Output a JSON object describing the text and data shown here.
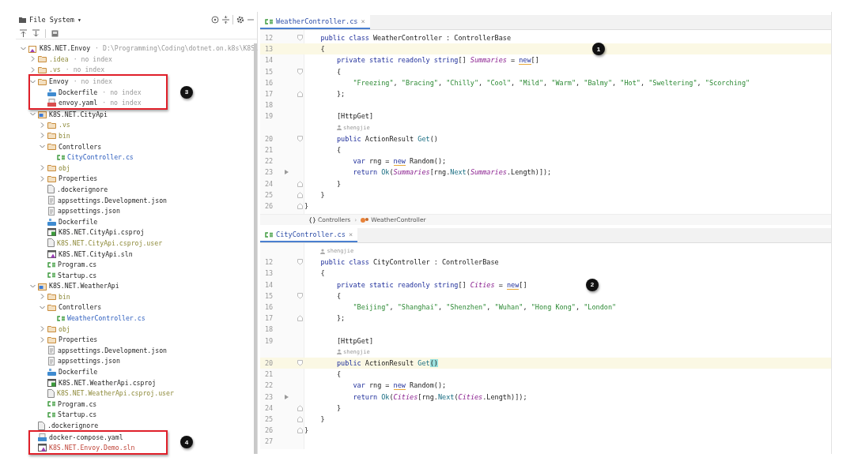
{
  "file_panel": {
    "title": "File System",
    "title_caret": "▾",
    "tree": [
      {
        "name": "K8S.NET.Envoy",
        "hint": "· D:\\Programming\\Coding\\dotnet.on.k8s\\K8S.",
        "kind": "solution",
        "ignored": false,
        "modified": false,
        "unversioned": false,
        "framed": false,
        "expanded": true,
        "children": [
          {
            "name": ".idea",
            "hint": "· no index",
            "kind": "folder",
            "ignored": true,
            "modified": false,
            "unversioned": false,
            "framed": false,
            "expanded": false
          },
          {
            "name": ".vs",
            "hint": "· no index",
            "kind": "folder",
            "ignored": true,
            "modified": false,
            "unversioned": false,
            "framed": false,
            "expanded": false
          },
          {
            "name": "Envoy",
            "hint": "· no index",
            "kind": "folder",
            "ignored": false,
            "modified": false,
            "unversioned": false,
            "framed": true,
            "callout": "3",
            "expanded": true,
            "children": [
              {
                "name": "Dockerfile",
                "hint": "· no index",
                "kind": "docker",
                "ignored": false,
                "modified": false,
                "unversioned": false,
                "framed": true
              },
              {
                "name": "envoy.yaml",
                "hint": "· no index",
                "kind": "yaml",
                "ignored": false,
                "modified": false,
                "unversioned": false,
                "framed": true
              }
            ]
          },
          {
            "name": "K8S.NET.CityApi",
            "kind": "project",
            "ignored": false,
            "modified": false,
            "unversioned": false,
            "framed": false,
            "expanded": true,
            "children": [
              {
                "name": ".vs",
                "kind": "folder",
                "ignored": true,
                "modified": false,
                "unversioned": false,
                "framed": false,
                "expanded": false
              },
              {
                "name": "bin",
                "kind": "folder",
                "ignored": true,
                "modified": false,
                "unversioned": false,
                "framed": false,
                "expanded": false
              },
              {
                "name": "Controllers",
                "kind": "folder",
                "ignored": false,
                "modified": false,
                "unversioned": false,
                "framed": false,
                "expanded": true,
                "children": [
                  {
                    "name": "CityController.cs",
                    "kind": "csharp",
                    "ignored": false,
                    "modified": true,
                    "unversioned": false,
                    "framed": false
                  }
                ]
              },
              {
                "name": "obj",
                "kind": "folder",
                "ignored": true,
                "modified": false,
                "unversioned": false,
                "framed": false,
                "expanded": false
              },
              {
                "name": "Properties",
                "kind": "folder",
                "ignored": false,
                "modified": false,
                "unversioned": false,
                "framed": false,
                "expanded": false
              },
              {
                "name": ".dockerignore",
                "kind": "text",
                "ignored": false,
                "modified": false,
                "unversioned": false,
                "framed": false
              },
              {
                "name": "appsettings.Development.json",
                "kind": "json",
                "ignored": false,
                "modified": false,
                "unversioned": false,
                "framed": false
              },
              {
                "name": "appsettings.json",
                "kind": "json",
                "ignored": false,
                "modified": false,
                "unversioned": false,
                "framed": false
              },
              {
                "name": "Dockerfile",
                "kind": "docker",
                "ignored": false,
                "modified": false,
                "unversioned": false,
                "framed": false
              },
              {
                "name": "K8S.NET.CityApi.csproj",
                "kind": "csproj",
                "ignored": false,
                "modified": false,
                "unversioned": false,
                "framed": false
              },
              {
                "name": "K8S.NET.CityApi.csproj.user",
                "kind": "text",
                "ignored": true,
                "modified": false,
                "unversioned": false,
                "framed": false
              },
              {
                "name": "K8S.NET.CityApi.sln",
                "kind": "sln",
                "ignored": false,
                "modified": false,
                "unversioned": false,
                "framed": false
              },
              {
                "name": "Program.cs",
                "kind": "csharp",
                "ignored": false,
                "modified": false,
                "unversioned": false,
                "framed": false
              },
              {
                "name": "Startup.cs",
                "kind": "csharp",
                "ignored": false,
                "modified": false,
                "unversioned": false,
                "framed": false
              }
            ]
          },
          {
            "name": "K8S.NET.WeatherApi",
            "kind": "project",
            "ignored": false,
            "modified": false,
            "unversioned": false,
            "framed": false,
            "expanded": true,
            "children": [
              {
                "name": "bin",
                "kind": "folder",
                "ignored": true,
                "modified": false,
                "unversioned": false,
                "framed": false,
                "expanded": false
              },
              {
                "name": "Controllers",
                "kind": "folder",
                "ignored": false,
                "modified": false,
                "unversioned": false,
                "framed": false,
                "expanded": true,
                "children": [
                  {
                    "name": "WeatherController.cs",
                    "kind": "csharp",
                    "ignored": false,
                    "modified": true,
                    "unversioned": false,
                    "framed": false
                  }
                ]
              },
              {
                "name": "obj",
                "kind": "folder",
                "ignored": true,
                "modified": false,
                "unversioned": false,
                "framed": false,
                "expanded": false
              },
              {
                "name": "Properties",
                "kind": "folder",
                "ignored": false,
                "modified": false,
                "unversioned": false,
                "framed": false,
                "expanded": false
              },
              {
                "name": "appsettings.Development.json",
                "kind": "json",
                "ignored": false,
                "modified": false,
                "unversioned": false,
                "framed": false
              },
              {
                "name": "appsettings.json",
                "kind": "json",
                "ignored": false,
                "modified": false,
                "unversioned": false,
                "framed": false
              },
              {
                "name": "Dockerfile",
                "kind": "docker",
                "ignored": false,
                "modified": false,
                "unversioned": false,
                "framed": false
              },
              {
                "name": "K8S.NET.WeatherApi.csproj",
                "kind": "csproj",
                "ignored": false,
                "modified": false,
                "unversioned": false,
                "framed": false
              },
              {
                "name": "K8S.NET.WeatherApi.csproj.user",
                "kind": "text",
                "ignored": true,
                "modified": false,
                "unversioned": false,
                "framed": false
              },
              {
                "name": "Program.cs",
                "kind": "csharp",
                "ignored": false,
                "modified": false,
                "unversioned": false,
                "framed": false
              },
              {
                "name": "Startup.cs",
                "kind": "csharp",
                "ignored": false,
                "modified": false,
                "unversioned": false,
                "framed": false
              }
            ]
          },
          {
            "name": ".dockerignore",
            "kind": "text",
            "ignored": false,
            "modified": false,
            "unversioned": false,
            "framed": false
          },
          {
            "name": "docker-compose.yaml",
            "kind": "compose",
            "ignored": false,
            "modified": false,
            "unversioned": false,
            "framed": true,
            "callout": "4"
          },
          {
            "name": "K8S.NET.Envoy.Demo.sln",
            "kind": "sln",
            "ignored": false,
            "modified": false,
            "unversioned": true,
            "framed": true
          }
        ]
      }
    ]
  },
  "editors": [
    {
      "tab": {
        "title": "WeatherController.cs",
        "close": "×"
      },
      "lines": [
        {
          "kind": "code",
          "number": "12",
          "fold_start": true,
          "fold_end": false,
          "run": false,
          "current": false,
          "tokens": [
            {
              "kind": "kw",
              "text": "    public class "
            },
            {
              "kind": "plain",
              "text": "WeatherController : ControllerBase"
            }
          ]
        },
        {
          "kind": "code",
          "number": "13",
          "fold_start": false,
          "fold_end": false,
          "run": false,
          "current": true,
          "callout": "1",
          "tokens": [
            {
              "kind": "plain",
              "text": "    {"
            }
          ]
        },
        {
          "kind": "code",
          "number": "14",
          "fold_start": false,
          "fold_end": false,
          "run": false,
          "current": false,
          "tokens": [
            {
              "kind": "kw",
              "text": "        private static readonly string"
            },
            {
              "kind": "plain",
              "text": "[] "
            },
            {
              "kind": "field",
              "text": "Summaries"
            },
            {
              "kind": "plain",
              "text": " = "
            },
            {
              "kind": "warn",
              "text": "new"
            },
            {
              "kind": "plain",
              "text": "[]"
            }
          ]
        },
        {
          "kind": "code",
          "number": "15",
          "fold_start": true,
          "fold_end": false,
          "run": false,
          "current": false,
          "tokens": [
            {
              "kind": "plain",
              "text": "        {"
            }
          ]
        },
        {
          "kind": "code",
          "number": "16",
          "fold_start": false,
          "fold_end": false,
          "run": false,
          "current": false,
          "tokens": [
            {
              "kind": "str",
              "text": "            \"Freezing\""
            },
            {
              "kind": "plain",
              "text": ", "
            },
            {
              "kind": "str",
              "text": "\"Bracing\""
            },
            {
              "kind": "plain",
              "text": ", "
            },
            {
              "kind": "str",
              "text": "\"Chilly\""
            },
            {
              "kind": "plain",
              "text": ", "
            },
            {
              "kind": "str",
              "text": "\"Cool\""
            },
            {
              "kind": "plain",
              "text": ", "
            },
            {
              "kind": "str",
              "text": "\"Mild\""
            },
            {
              "kind": "plain",
              "text": ", "
            },
            {
              "kind": "str",
              "text": "\"Warm\""
            },
            {
              "kind": "plain",
              "text": ", "
            },
            {
              "kind": "str",
              "text": "\"Balmy\""
            },
            {
              "kind": "plain",
              "text": ", "
            },
            {
              "kind": "str",
              "text": "\"Hot\""
            },
            {
              "kind": "plain",
              "text": ", "
            },
            {
              "kind": "str",
              "text": "\"Sweltering\""
            },
            {
              "kind": "plain",
              "text": ", "
            },
            {
              "kind": "str",
              "text": "\"Scorching\""
            }
          ]
        },
        {
          "kind": "code",
          "number": "17",
          "fold_start": false,
          "fold_end": true,
          "run": false,
          "current": false,
          "tokens": [
            {
              "kind": "plain",
              "text": "        };"
            }
          ]
        },
        {
          "kind": "code",
          "number": "18",
          "fold_start": false,
          "fold_end": false,
          "run": false,
          "current": false
        },
        {
          "kind": "code",
          "number": "19",
          "fold_start": false,
          "fold_end": false,
          "run": false,
          "current": false,
          "tokens": [
            {
              "kind": "plain",
              "text": "        [HttpGet]"
            }
          ]
        },
        {
          "kind": "author",
          "text": "shengjie"
        },
        {
          "kind": "code",
          "number": "20",
          "fold_start": true,
          "fold_end": false,
          "run": false,
          "current": false,
          "tokens": [
            {
              "kind": "kw",
              "text": "        public "
            },
            {
              "kind": "plain",
              "text": "ActionResult "
            },
            {
              "kind": "method",
              "text": "Get"
            },
            {
              "kind": "plain",
              "text": "()"
            }
          ]
        },
        {
          "kind": "code",
          "number": "21",
          "fold_start": false,
          "fold_end": false,
          "run": false,
          "current": false,
          "tokens": [
            {
              "kind": "plain",
              "text": "        {"
            }
          ]
        },
        {
          "kind": "code",
          "number": "22",
          "fold_start": false,
          "fold_end": false,
          "run": false,
          "current": false,
          "tokens": [
            {
              "kind": "kw",
              "text": "            var "
            },
            {
              "kind": "plain",
              "text": "rng = "
            },
            {
              "kind": "warn",
              "text": "new"
            },
            {
              "kind": "plain",
              "text": " Random();"
            }
          ]
        },
        {
          "kind": "code",
          "number": "23",
          "fold_start": false,
          "fold_end": false,
          "run": true,
          "current": false,
          "tokens": [
            {
              "kind": "kw",
              "text": "            return "
            },
            {
              "kind": "method",
              "text": "Ok"
            },
            {
              "kind": "plain",
              "text": "("
            },
            {
              "kind": "field",
              "text": "Summaries"
            },
            {
              "kind": "plain",
              "text": "[rng."
            },
            {
              "kind": "method",
              "text": "Next"
            },
            {
              "kind": "plain",
              "text": "("
            },
            {
              "kind": "field",
              "text": "Summaries"
            },
            {
              "kind": "plain",
              "text": ".Length)]);"
            }
          ]
        },
        {
          "kind": "code",
          "number": "24",
          "fold_start": false,
          "fold_end": true,
          "run": false,
          "current": false,
          "tokens": [
            {
              "kind": "plain",
              "text": "        }"
            }
          ]
        },
        {
          "kind": "code",
          "number": "25",
          "fold_start": false,
          "fold_end": true,
          "run": false,
          "current": false,
          "tokens": [
            {
              "kind": "plain",
              "text": "    }"
            }
          ]
        },
        {
          "kind": "code",
          "number": "26",
          "fold_start": false,
          "fold_end": true,
          "run": false,
          "current": false,
          "tokens": [
            {
              "kind": "plain",
              "text": "}"
            }
          ]
        }
      ],
      "breadcrumb": [
        {
          "kind": "namespace",
          "text": "Controllers"
        },
        {
          "kind": "class",
          "text": "WeatherController"
        }
      ],
      "breadcrumb_separator": "›"
    },
    {
      "tab": {
        "title": "CityController.cs",
        "close": "×"
      },
      "lines": [
        {
          "kind": "author",
          "text": "shengjie"
        },
        {
          "kind": "code",
          "number": "12",
          "fold_start": true,
          "fold_end": false,
          "run": false,
          "current": false,
          "tokens": [
            {
              "kind": "kw",
              "text": "    public class "
            },
            {
              "kind": "plain",
              "text": "CityController : ControllerBase"
            }
          ]
        },
        {
          "kind": "code",
          "number": "13",
          "fold_start": false,
          "fold_end": false,
          "run": false,
          "current": false,
          "tokens": [
            {
              "kind": "plain",
              "text": "    {"
            }
          ]
        },
        {
          "kind": "code",
          "number": "14",
          "fold_start": false,
          "fold_end": false,
          "run": false,
          "current": false,
          "callout": "2",
          "tokens": [
            {
              "kind": "kw",
              "text": "        private static readonly string"
            },
            {
              "kind": "plain",
              "text": "[] "
            },
            {
              "kind": "field",
              "text": "Cities"
            },
            {
              "kind": "plain",
              "text": " = "
            },
            {
              "kind": "warn",
              "text": "new"
            },
            {
              "kind": "plain",
              "text": "[]"
            }
          ]
        },
        {
          "kind": "code",
          "number": "15",
          "fold_start": true,
          "fold_end": false,
          "run": false,
          "current": false,
          "tokens": [
            {
              "kind": "plain",
              "text": "        {"
            }
          ]
        },
        {
          "kind": "code",
          "number": "16",
          "fold_start": false,
          "fold_end": false,
          "run": false,
          "current": false,
          "tokens": [
            {
              "kind": "str",
              "text": "            \"Beijing\""
            },
            {
              "kind": "plain",
              "text": ", "
            },
            {
              "kind": "str",
              "text": "\"Shanghai\""
            },
            {
              "kind": "plain",
              "text": ", "
            },
            {
              "kind": "str",
              "text": "\"Shenzhen\""
            },
            {
              "kind": "plain",
              "text": ", "
            },
            {
              "kind": "str",
              "text": "\"Wuhan\""
            },
            {
              "kind": "plain",
              "text": ", "
            },
            {
              "kind": "str",
              "text": "\"Hong Kong\""
            },
            {
              "kind": "plain",
              "text": ", "
            },
            {
              "kind": "str",
              "text": "\"London\""
            }
          ]
        },
        {
          "kind": "code",
          "number": "17",
          "fold_start": false,
          "fold_end": true,
          "run": false,
          "current": false,
          "tokens": [
            {
              "kind": "plain",
              "text": "        };"
            }
          ]
        },
        {
          "kind": "code",
          "number": "18",
          "fold_start": false,
          "fold_end": false,
          "run": false,
          "current": false
        },
        {
          "kind": "code",
          "number": "19",
          "fold_start": false,
          "fold_end": false,
          "run": false,
          "current": false,
          "tokens": [
            {
              "kind": "plain",
              "text": "        [HttpGet]"
            }
          ]
        },
        {
          "kind": "author",
          "text": "shengjie"
        },
        {
          "kind": "code",
          "number": "20",
          "fold_start": true,
          "fold_end": false,
          "run": false,
          "current": true,
          "tokens": [
            {
              "kind": "kw",
              "text": "        public "
            },
            {
              "kind": "plain",
              "text": "ActionResult "
            },
            {
              "kind": "method",
              "text": "Get"
            },
            {
              "kind": "match",
              "text": "()"
            }
          ]
        },
        {
          "kind": "code",
          "number": "21",
          "fold_start": false,
          "fold_end": false,
          "run": false,
          "current": false,
          "tokens": [
            {
              "kind": "plain",
              "text": "        {"
            }
          ]
        },
        {
          "kind": "code",
          "number": "22",
          "fold_start": false,
          "fold_end": false,
          "run": false,
          "current": false,
          "tokens": [
            {
              "kind": "kw",
              "text": "            var "
            },
            {
              "kind": "plain",
              "text": "rng = "
            },
            {
              "kind": "warn",
              "text": "new"
            },
            {
              "kind": "plain",
              "text": " Random();"
            }
          ]
        },
        {
          "kind": "code",
          "number": "23",
          "fold_start": false,
          "fold_end": false,
          "run": true,
          "current": false,
          "tokens": [
            {
              "kind": "kw",
              "text": "            return "
            },
            {
              "kind": "method",
              "text": "Ok"
            },
            {
              "kind": "plain",
              "text": "("
            },
            {
              "kind": "field",
              "text": "Cities"
            },
            {
              "kind": "plain",
              "text": "[rng."
            },
            {
              "kind": "method",
              "text": "Next"
            },
            {
              "kind": "plain",
              "text": "("
            },
            {
              "kind": "field",
              "text": "Cities"
            },
            {
              "kind": "plain",
              "text": ".Length)]);"
            }
          ]
        },
        {
          "kind": "code",
          "number": "24",
          "fold_start": false,
          "fold_end": true,
          "run": false,
          "current": false,
          "tokens": [
            {
              "kind": "plain",
              "text": "        }"
            }
          ]
        },
        {
          "kind": "code",
          "number": "25",
          "fold_start": false,
          "fold_end": true,
          "run": false,
          "current": false,
          "tokens": [
            {
              "kind": "plain",
              "text": "    }"
            }
          ]
        },
        {
          "kind": "code",
          "number": "26",
          "fold_start": false,
          "fold_end": true,
          "run": false,
          "current": false,
          "tokens": [
            {
              "kind": "plain",
              "text": "}"
            }
          ]
        },
        {
          "kind": "code",
          "number": "27",
          "fold_start": false,
          "fold_end": false,
          "run": false,
          "current": false
        }
      ]
    }
  ]
}
